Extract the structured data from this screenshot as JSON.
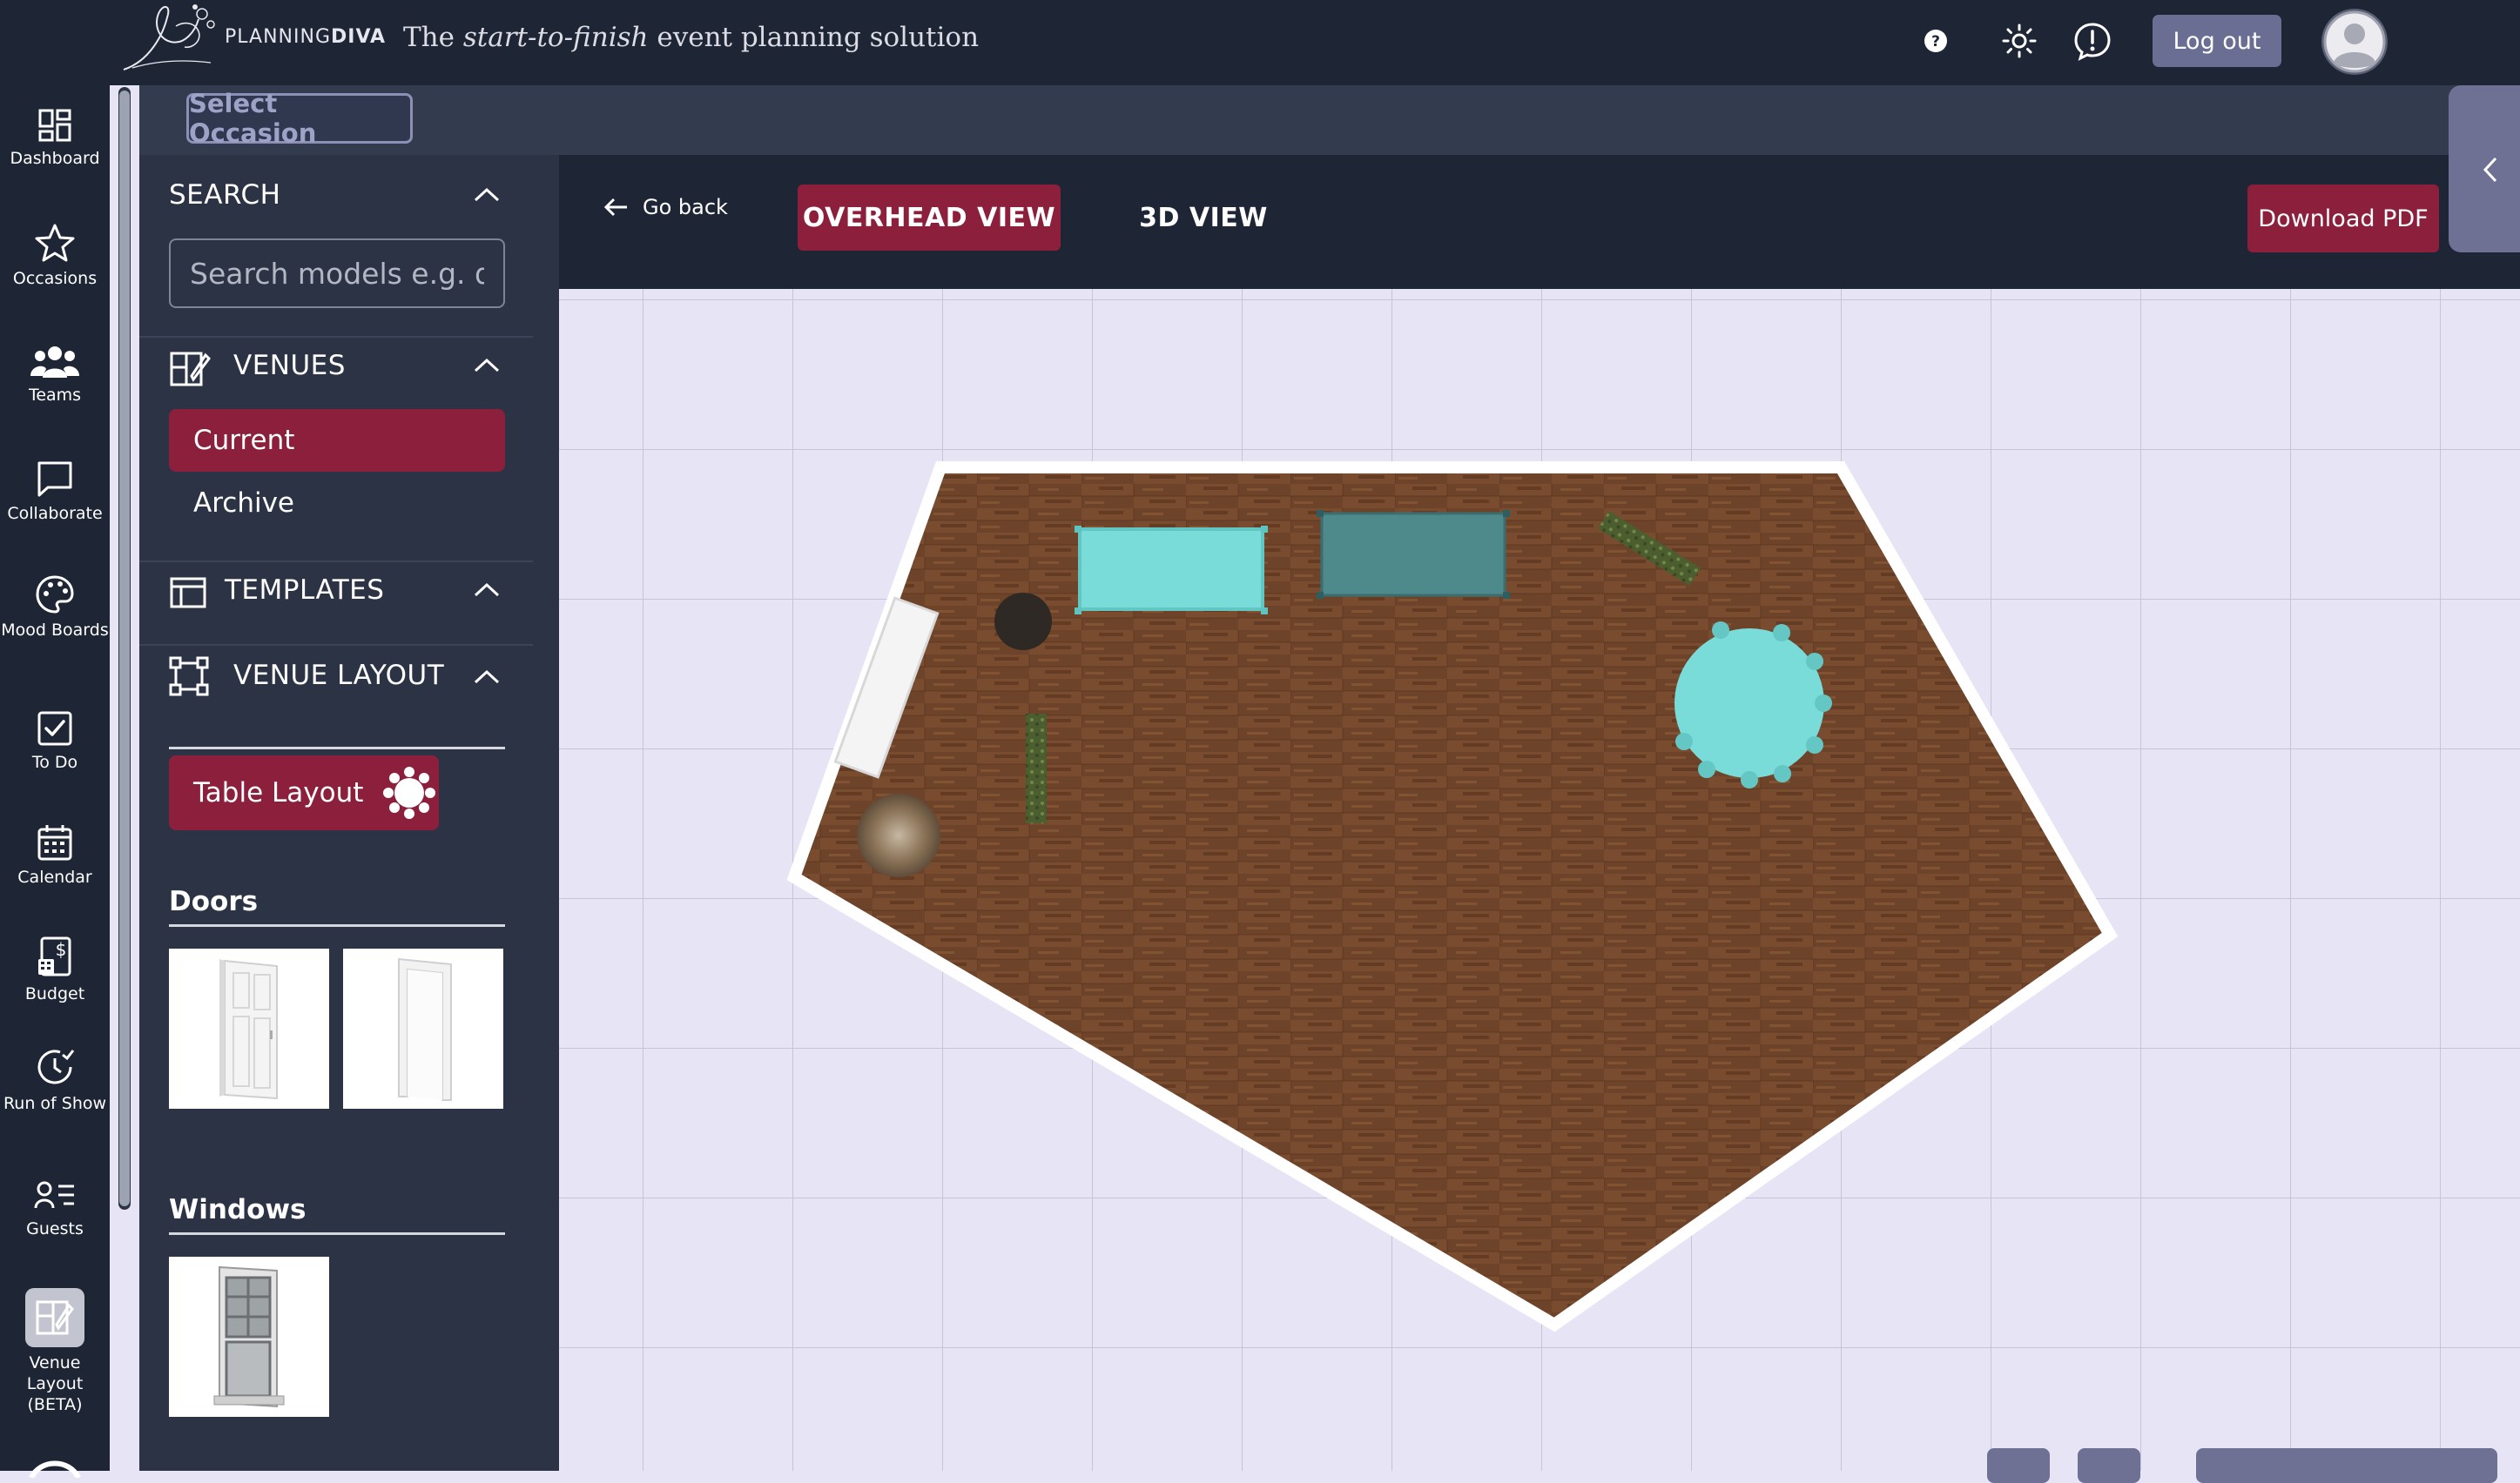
{
  "header": {
    "logo_text_1": "PLANNING",
    "logo_text_2": "DIVA",
    "tagline_prefix": "The",
    "tagline_emphasis": "start-to-finish",
    "tagline_suffix": "event planning solution",
    "logout_label": "Log out"
  },
  "nav": {
    "items": [
      {
        "label": "Dashboard"
      },
      {
        "label": "Occasions"
      },
      {
        "label": "Teams"
      },
      {
        "label": "Collaborate"
      },
      {
        "label": "Mood Boards"
      },
      {
        "label": "To Do"
      },
      {
        "label": "Calendar"
      },
      {
        "label": "Budget"
      },
      {
        "label": "Run of Show"
      },
      {
        "label": "Guests"
      },
      {
        "label": "Venue Layout (BETA)",
        "active": true
      }
    ]
  },
  "occasion": {
    "select_label": "Select Occasion"
  },
  "panel": {
    "search_title": "SEARCH",
    "search_placeholder": "Search models e.g. desk",
    "venues_title": "VENUES",
    "venues_items": [
      "Current",
      "Archive"
    ],
    "templates_title": "TEMPLATES",
    "venue_layout_title": "VENUE LAYOUT",
    "table_layout_label": "Table Layout",
    "doors_title": "Doors",
    "windows_title": "Windows"
  },
  "viewer": {
    "go_back_label": "Go back",
    "overhead_label": "OVERHEAD VIEW",
    "view_3d_label": "3D VIEW",
    "download_pdf_label": "Download PDF"
  },
  "colors": {
    "accent": "#8c1f3c",
    "nav_bg": "#1e2535",
    "panel_bg": "#2b3345",
    "canvas_bg": "#e7e5f5",
    "floor_wood": "#6b4228",
    "table_cyan": "#7adcd8",
    "table_dark_teal": "#4e8a8c"
  },
  "icons": {
    "help": "question-circle-icon",
    "theme": "sun-icon",
    "feedback": "alert-bubble-icon",
    "avatar": "user-avatar-icon"
  }
}
